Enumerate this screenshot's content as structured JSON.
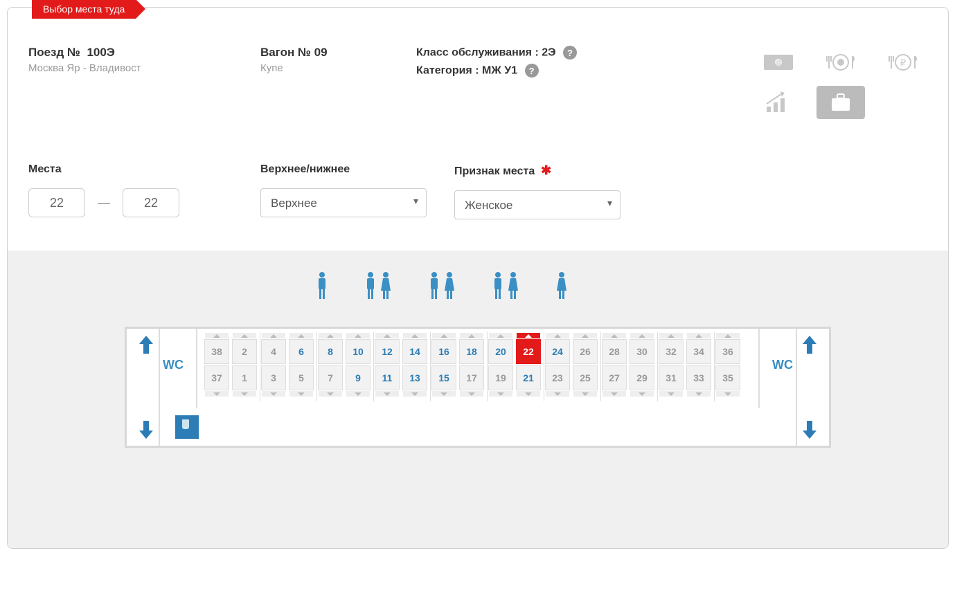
{
  "tab": "Выбор места туда",
  "train": {
    "label": "Поезд №",
    "number": "100Э",
    "route": "Москва Яр - Владивост"
  },
  "car": {
    "label": "Вагон № 09",
    "type": "Купе"
  },
  "serviceClass": {
    "label": "Класс обслуживания :",
    "value": "2Э"
  },
  "category": {
    "label": "Категория :",
    "value": "МЖ У1"
  },
  "filters": {
    "seats": {
      "label": "Места",
      "from": "22",
      "to": "22"
    },
    "berth": {
      "label": "Верхнее/нижнее",
      "value": "Верхнее"
    },
    "gender": {
      "label": "Признак места",
      "value": "Женское"
    }
  },
  "wc": "WC",
  "genderGroups": [
    "male",
    "male-female",
    "male-female",
    "male-female",
    "female"
  ],
  "compartments": [
    {
      "upper": [
        {
          "n": "38",
          "s": "na"
        },
        {
          "n": "2",
          "s": "na"
        }
      ],
      "lower": [
        {
          "n": "37",
          "s": "na"
        },
        {
          "n": "1",
          "s": "na"
        }
      ]
    },
    {
      "upper": [
        {
          "n": "4",
          "s": "na"
        },
        {
          "n": "6",
          "s": "avail"
        }
      ],
      "lower": [
        {
          "n": "3",
          "s": "na"
        },
        {
          "n": "5",
          "s": "na"
        }
      ]
    },
    {
      "upper": [
        {
          "n": "8",
          "s": "avail"
        },
        {
          "n": "10",
          "s": "avail"
        }
      ],
      "lower": [
        {
          "n": "7",
          "s": "na"
        },
        {
          "n": "9",
          "s": "avail"
        }
      ]
    },
    {
      "upper": [
        {
          "n": "12",
          "s": "avail"
        },
        {
          "n": "14",
          "s": "avail"
        }
      ],
      "lower": [
        {
          "n": "11",
          "s": "avail"
        },
        {
          "n": "13",
          "s": "avail"
        }
      ]
    },
    {
      "upper": [
        {
          "n": "16",
          "s": "avail"
        },
        {
          "n": "18",
          "s": "avail"
        }
      ],
      "lower": [
        {
          "n": "15",
          "s": "avail"
        },
        {
          "n": "17",
          "s": "na"
        }
      ]
    },
    {
      "upper": [
        {
          "n": "20",
          "s": "avail"
        },
        {
          "n": "22",
          "s": "selected"
        }
      ],
      "lower": [
        {
          "n": "19",
          "s": "na"
        },
        {
          "n": "21",
          "s": "avail"
        }
      ]
    },
    {
      "upper": [
        {
          "n": "24",
          "s": "avail"
        },
        {
          "n": "26",
          "s": "na"
        }
      ],
      "lower": [
        {
          "n": "23",
          "s": "na"
        },
        {
          "n": "25",
          "s": "na"
        }
      ]
    },
    {
      "upper": [
        {
          "n": "28",
          "s": "na"
        },
        {
          "n": "30",
          "s": "na"
        }
      ],
      "lower": [
        {
          "n": "27",
          "s": "na"
        },
        {
          "n": "29",
          "s": "na"
        }
      ]
    },
    {
      "upper": [
        {
          "n": "32",
          "s": "na"
        },
        {
          "n": "34",
          "s": "na"
        }
      ],
      "lower": [
        {
          "n": "31",
          "s": "na"
        },
        {
          "n": "33",
          "s": "na"
        }
      ]
    },
    {
      "upper": [
        {
          "n": "36",
          "s": "na"
        }
      ],
      "lower": [
        {
          "n": "35",
          "s": "na"
        }
      ]
    }
  ]
}
